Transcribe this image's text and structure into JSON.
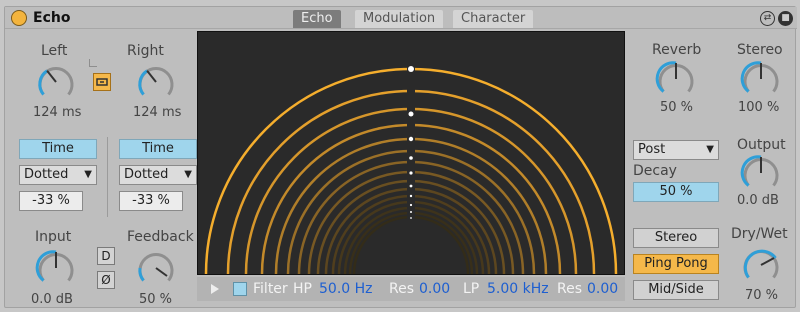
{
  "header": {
    "title": "Echo",
    "tabs": [
      {
        "label": "Echo",
        "active": true
      },
      {
        "label": "Modulation",
        "active": false
      },
      {
        "label": "Character",
        "active": false
      }
    ]
  },
  "left_section": {
    "left": {
      "label": "Left",
      "value": "124 ms",
      "mode_button": "Time",
      "sync_select": "Dotted",
      "offset": "-33 %"
    },
    "right": {
      "label": "Right",
      "value": "124 ms",
      "mode_button": "Time",
      "sync_select": "Dotted",
      "offset": "-33 %"
    },
    "input": {
      "label": "Input",
      "value": "0.0 dB"
    },
    "feedback": {
      "label": "Feedback",
      "value": "50 %"
    },
    "d_button": "D",
    "phase_button": "Ø"
  },
  "filter_bar": {
    "label": "Filter",
    "hp_label": "HP",
    "hp_value": "50.0 Hz",
    "hp_res_label": "Res",
    "hp_res_value": "0.00",
    "lp_label": "LP",
    "lp_value": "5.00 kHz",
    "lp_res_label": "Res",
    "lp_res_value": "0.00"
  },
  "right_section": {
    "reverb": {
      "label": "Reverb",
      "value": "50 %"
    },
    "stereo": {
      "label": "Stereo",
      "value": "100 %"
    },
    "reverb_position_select": "Post",
    "decay": {
      "label": "Decay",
      "value": "50 %"
    },
    "output": {
      "label": "Output",
      "value": "0.0 dB"
    },
    "channel_modes": [
      "Stereo",
      "Ping Pong",
      "Mid/Side"
    ],
    "active_channel_mode": "Ping Pong",
    "drywet": {
      "label": "Dry/Wet",
      "value": "70 %"
    }
  },
  "colors": {
    "accent_orange": "#f5b84a",
    "accent_blue": "#9fd5ec",
    "display_bg": "#2a2a2a",
    "value_blue": "#1e5fd0"
  },
  "icons": [
    "power-icon",
    "chain-link-icon",
    "hot-swap-icon",
    "save-preset-icon",
    "play-icon"
  ]
}
